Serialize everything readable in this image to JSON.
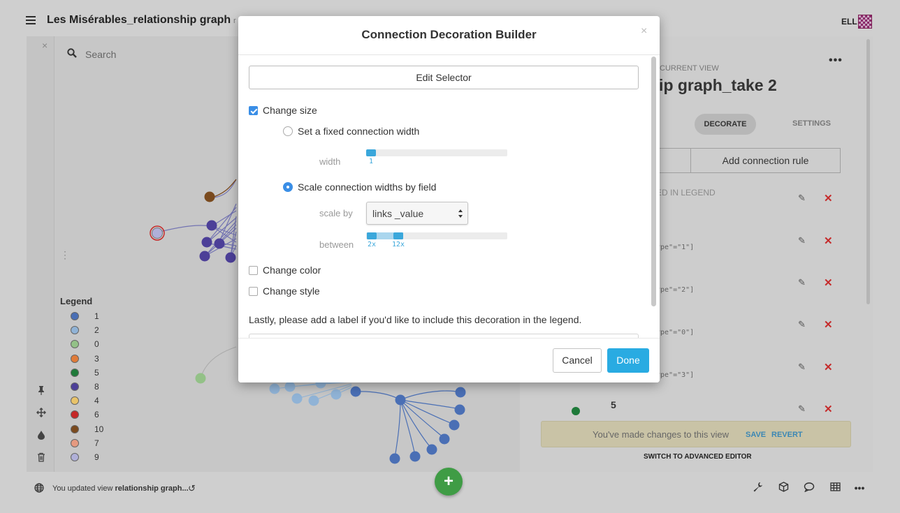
{
  "app": {
    "title": "Les Misérables_relationship graph",
    "title_tail": "r",
    "user_initials": "ELL"
  },
  "canvas": {
    "search_placeholder": "Search",
    "close_glyph": "×",
    "legend_title": "Legend",
    "legend_items": [
      {
        "label": "1",
        "color": "#4a6fb5"
      },
      {
        "label": "2",
        "color": "#90b3d6"
      },
      {
        "label": "0",
        "color": "#93c187"
      },
      {
        "label": "3",
        "color": "#e07b39"
      },
      {
        "label": "5",
        "color": "#1f7a3a"
      },
      {
        "label": "8",
        "color": "#4c3f98"
      },
      {
        "label": "4",
        "color": "#e8c36a"
      },
      {
        "label": "6",
        "color": "#c62828"
      },
      {
        "label": "10",
        "color": "#7a4a1e"
      },
      {
        "label": "7",
        "color": "#e59a80"
      },
      {
        "label": "9",
        "color": "#b0b0d8"
      }
    ],
    "tools": [
      "pin-icon",
      "move-icon",
      "drop-icon",
      "trash-icon"
    ]
  },
  "right_panel": {
    "current_view_label": "CURRENT VIEW",
    "view_title": "hip graph_take 2",
    "more_glyph": "•••",
    "tabs": {
      "decorate": "DECORATE",
      "settings": "SETTINGS"
    },
    "add_connection_rule": "Add connection rule",
    "legend_note": "ED IN LEGEND",
    "rules": [
      {
        "code": "ype\"=\"1\"]"
      },
      {
        "code": "ype\"=\"2\"]"
      },
      {
        "code": "ype\"=\"0\"]"
      },
      {
        "code": "ype\"=\"3\"]"
      }
    ],
    "partial_rule_label": "5",
    "changes_banner": {
      "text": "You've made changes to this view",
      "save": "SAVE",
      "revert": "REVERT"
    },
    "advanced_editor": "SWITCH TO ADVANCED EDITOR"
  },
  "status_bar": {
    "prefix": "You updated view ",
    "view_name": "relationship graph...",
    "add_glyph": "+"
  },
  "modal": {
    "title": "Connection Decoration Builder",
    "close_glyph": "×",
    "edit_selector": "Edit Selector",
    "change_size": {
      "label": "Change size",
      "checked": true
    },
    "fixed_width": {
      "label": "Set a fixed connection width",
      "selected": false,
      "field_label": "width",
      "value": 1,
      "value_text": "1"
    },
    "scale_by_field": {
      "label": "Scale connection widths by field",
      "selected": true,
      "scale_by_label": "scale by",
      "scale_by_value": "links _value",
      "between_label": "between",
      "min": 2,
      "max": 12,
      "min_text": "2x",
      "max_text": "12x"
    },
    "change_color": {
      "label": "Change color",
      "checked": false
    },
    "change_style": {
      "label": "Change style",
      "checked": false
    },
    "legend_prompt": "Lastly, please add a label if you'd like to include this decoration in the legend.",
    "cancel": "Cancel",
    "done": "Done"
  },
  "colors": {
    "accent": "#29abe2",
    "checkbox": "#3a8ee6",
    "delete": "#c52b2b",
    "fab": "#3f9c45"
  }
}
